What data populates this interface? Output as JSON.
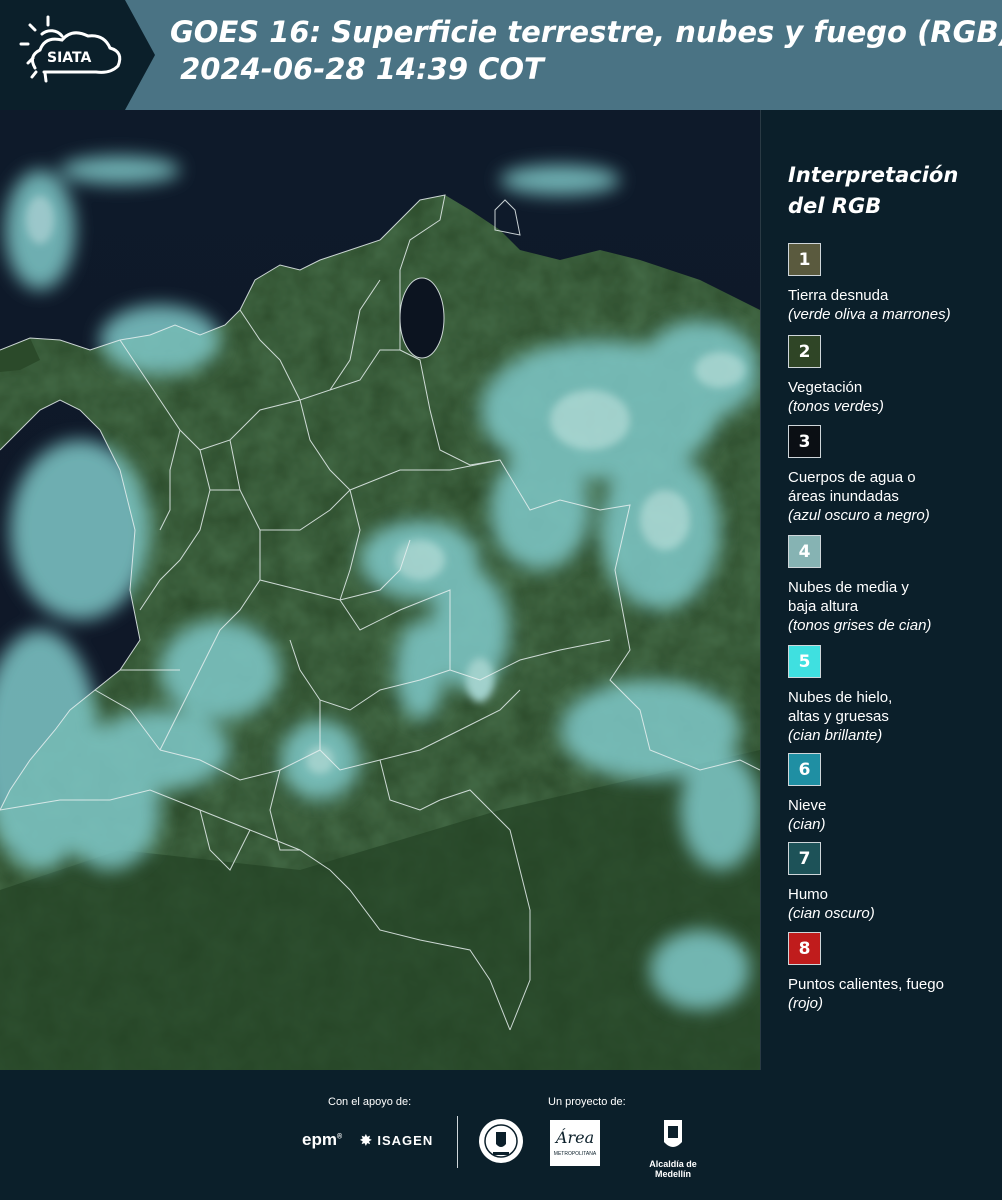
{
  "header": {
    "logo_text": "SIATA",
    "title": "GOES 16: Superficie terrestre, nubes y fuego (RGB)\n 2024-06-28 14:39 COT"
  },
  "legend": {
    "title": "Interpretación\ndel RGB",
    "items": [
      {
        "num": "1",
        "label": "Tierra desnuda",
        "desc": "(verde oliva a marrones)",
        "color": "#5a5a3e"
      },
      {
        "num": "2",
        "label": "Vegetación",
        "desc": "(tonos verdes)",
        "color": "#2f4526"
      },
      {
        "num": "3",
        "label": "Cuerpos de agua o\náreas inundadas",
        "desc": "(azul oscuro a negro)",
        "color": "#0b0f14"
      },
      {
        "num": "4",
        "label": "Nubes de media y\nbaja altura",
        "desc": "(tonos grises de cian)",
        "color": "#86b3b3"
      },
      {
        "num": "5",
        "label": "Nubes de hielo,\naltas y gruesas",
        "desc": "(cian brillante)",
        "color": "#3fe0e0"
      },
      {
        "num": "6",
        "label": "Nieve",
        "desc": "(cian)",
        "color": "#1f8fa3"
      },
      {
        "num": "7",
        "label": "Humo",
        "desc": "(cian oscuro)",
        "color": "#1d5258"
      },
      {
        "num": "8",
        "label": "Puntos calientes, fuego",
        "desc": "(rojo)",
        "color": "#c01c1c"
      }
    ]
  },
  "footer": {
    "support_label": "Con el apoyo de:",
    "project_label": "Un proyecto de:",
    "sponsors": {
      "epm": "epm",
      "isagen": "ISAGEN",
      "area": "Área",
      "area_sub": "METROPOLITANA",
      "alcaldia": "Alcaldía de Medellín"
    }
  }
}
